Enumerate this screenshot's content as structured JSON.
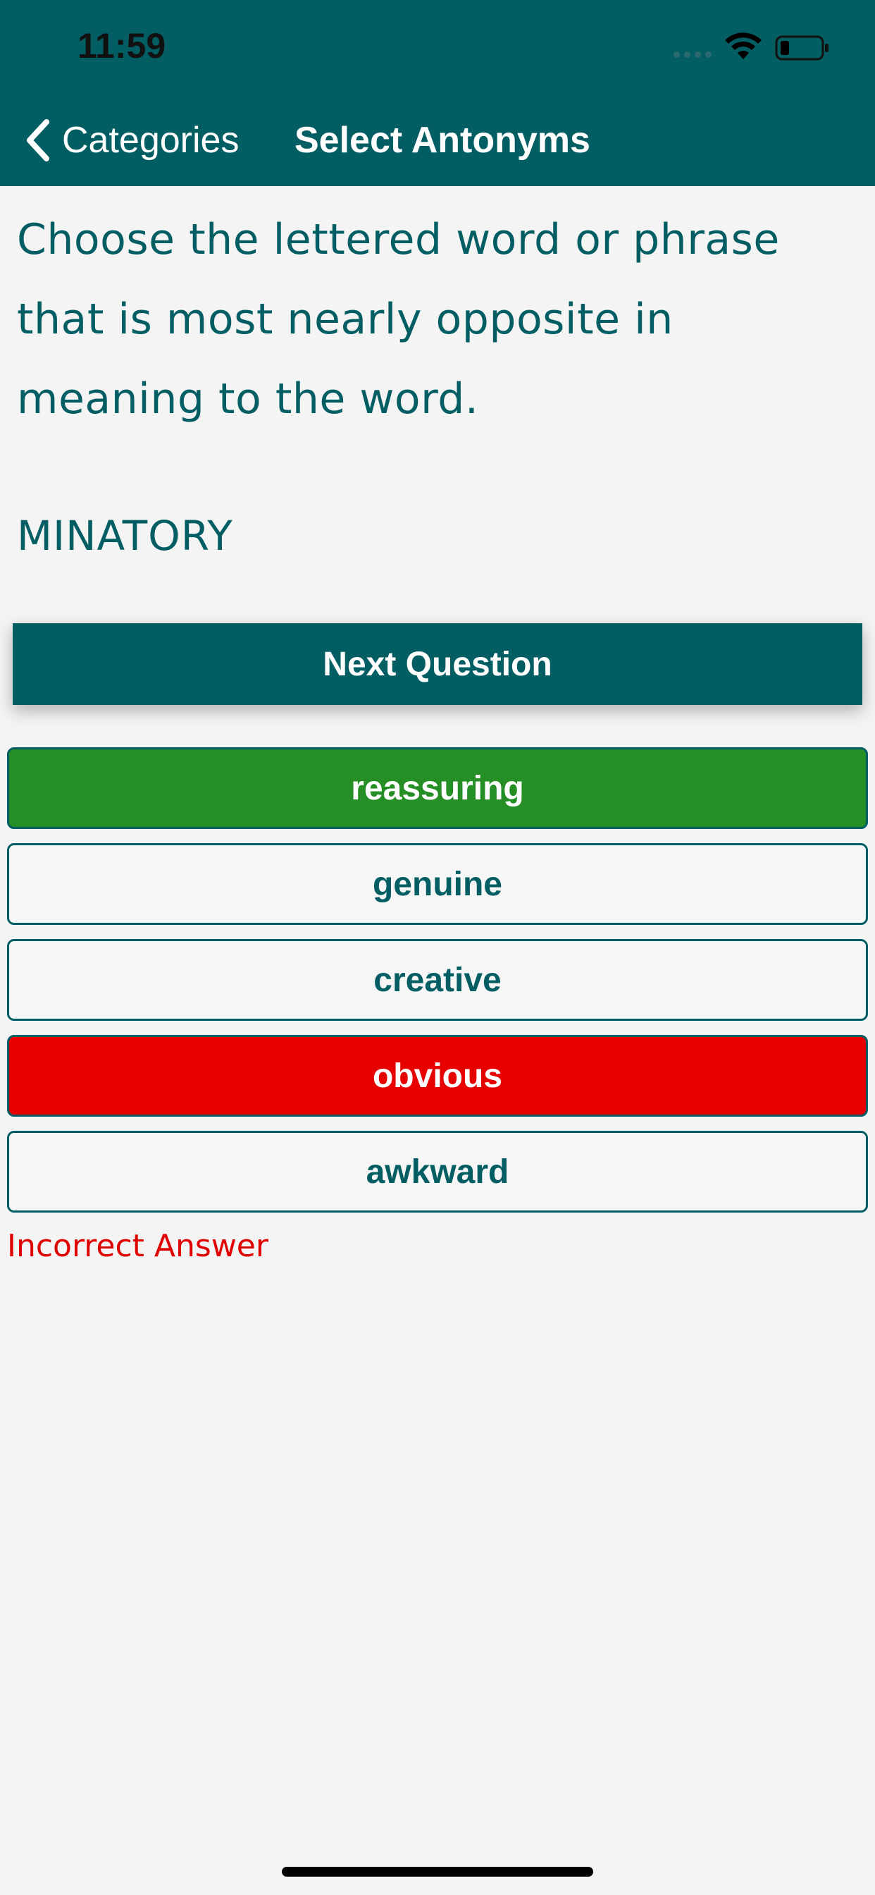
{
  "status_bar": {
    "time": "11:59"
  },
  "nav": {
    "back_label": "Categories",
    "title": "Select Antonyms"
  },
  "question": {
    "instructions": "Choose the lettered word or phrase that is most nearly opposite in meaning to the word.",
    "word": "MINATORY"
  },
  "next_button_label": "Next Question",
  "options": [
    {
      "label": "reassuring",
      "state": "correct"
    },
    {
      "label": "genuine",
      "state": "neutral"
    },
    {
      "label": "creative",
      "state": "neutral"
    },
    {
      "label": "obvious",
      "state": "wrong"
    },
    {
      "label": "awkward",
      "state": "neutral"
    }
  ],
  "feedback": "Incorrect Answer",
  "colors": {
    "primary": "#035e63",
    "correct": "#258f25",
    "wrong": "#e60000",
    "background": "#f4f4f4"
  },
  "icons": {
    "back": "chevron-left-icon",
    "wifi": "wifi-icon",
    "battery": "battery-icon",
    "signal": "signal-dots-icon"
  }
}
